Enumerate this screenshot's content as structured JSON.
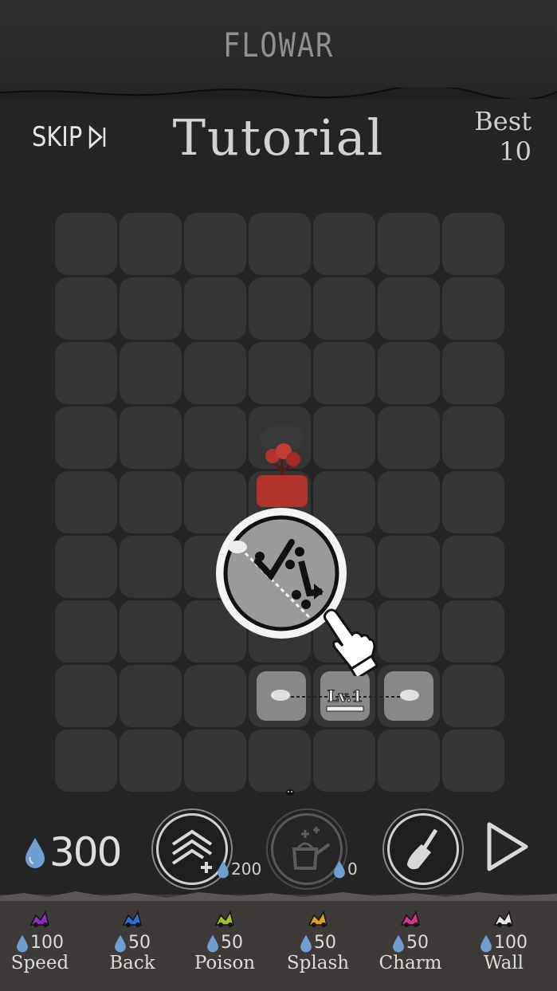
{
  "header": {
    "app_title": "FLOWAR"
  },
  "top": {
    "skip_label": "SKIP",
    "skip_icon": "skip-next-icon",
    "title": "Tutorial",
    "best_label": "Best",
    "best_value": "10"
  },
  "board": {
    "rows": 9,
    "cols": 7,
    "level_label": "Lv.1"
  },
  "bottom": {
    "water_amount": "300",
    "upgrade_cost": "200",
    "water_can_cost": "0",
    "icons": {
      "upgrade": "chevron-up-plus-icon",
      "watering": "watering-can-icon",
      "shovel": "shovel-icon",
      "play": "play-icon"
    }
  },
  "shop": [
    {
      "name": "Speed",
      "price": "100",
      "color": "#8a2fc2"
    },
    {
      "name": "Back",
      "price": "50",
      "color": "#2f6fd6"
    },
    {
      "name": "Poison",
      "price": "50",
      "color": "#9fbf2a"
    },
    {
      "name": "Splash",
      "price": "50",
      "color": "#e0a020"
    },
    {
      "name": "Charm",
      "price": "50",
      "color": "#d8368e"
    },
    {
      "name": "Wall",
      "price": "100",
      "color": "#e8e8e8"
    }
  ],
  "colors": {
    "background": "#242424",
    "cell": "#353535",
    "water": "#6f9fd0",
    "flower": "#b0332c"
  }
}
